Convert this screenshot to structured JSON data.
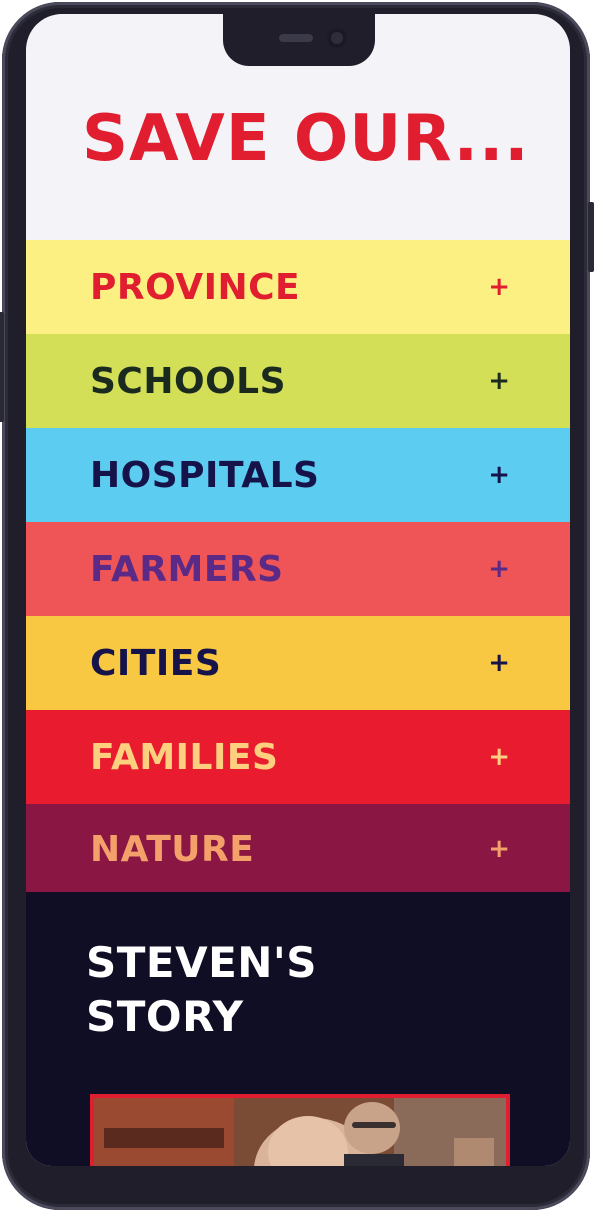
{
  "headline": "SAVE OUR...",
  "menu": {
    "items": [
      {
        "label": "PROVINCE",
        "bg": "#fdf082",
        "fg": "#e01e30"
      },
      {
        "label": "SCHOOLS",
        "bg": "#d4df58",
        "fg": "#1a2a1e"
      },
      {
        "label": "HOSPITALS",
        "bg": "#5ccdf0",
        "fg": "#15134a"
      },
      {
        "label": "FARMERS",
        "bg": "#ef5557",
        "fg": "#5a2a86"
      },
      {
        "label": "CITIES",
        "bg": "#f9c842",
        "fg": "#15134a"
      },
      {
        "label": "FAMILIES",
        "bg": "#e81c2e",
        "fg": "#fdd080"
      },
      {
        "label": "NATURE",
        "bg": "#8a1644",
        "fg": "#f4a06a"
      }
    ],
    "expand_symbol": "+"
  },
  "story": {
    "title_line1": "STEVEN'S",
    "title_line2": "STORY",
    "bg": "#0f0e24"
  },
  "colors": {
    "accent_red": "#e01e30",
    "screen_bg": "#f4f3f7",
    "frame": "#1f1e2a"
  }
}
